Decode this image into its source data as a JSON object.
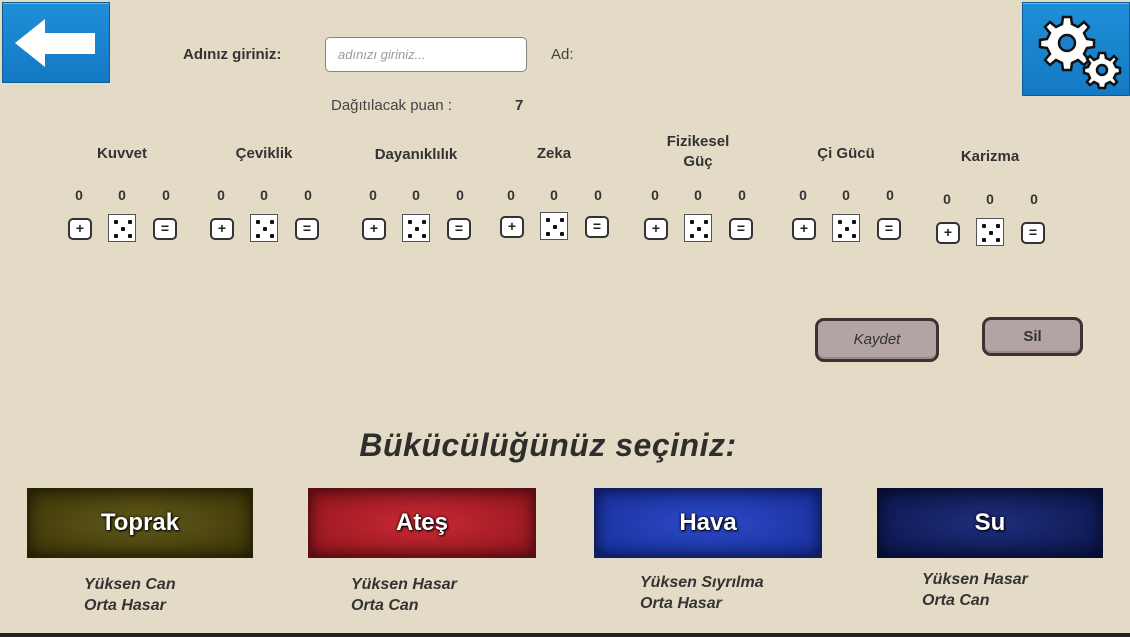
{
  "header": {
    "back_icon": "arrow-left-icon",
    "settings_icon": "gears-icon",
    "accent": "#1880cc"
  },
  "name": {
    "label": "Adınız giriniz:",
    "placeholder": "adınızı giriniz...",
    "value": "",
    "ad_label": "Ad:"
  },
  "points": {
    "label": "Dağıtılacak puan :",
    "value": "7"
  },
  "stats": [
    {
      "name": "Kuvvet",
      "values": [
        "0",
        "0",
        "0"
      ],
      "plus": "+",
      "minus": "=",
      "die_face": 5
    },
    {
      "name": "Çeviklik",
      "values": [
        "0",
        "0",
        "0"
      ],
      "plus": "+",
      "minus": "=",
      "die_face": 5
    },
    {
      "name": "Dayanıklılık",
      "values": [
        "0",
        "0",
        "0"
      ],
      "plus": "+",
      "minus": "=",
      "die_face": 5
    },
    {
      "name": "Zeka",
      "values": [
        "0",
        "0",
        "0"
      ],
      "plus": "+",
      "minus": "=",
      "die_face": 5
    },
    {
      "name": "Fizikesel\nGüç",
      "values": [
        "0",
        "0",
        "0"
      ],
      "plus": "+",
      "minus": "=",
      "die_face": 5
    },
    {
      "name": "Çi Gücü",
      "values": [
        "0",
        "0",
        "0"
      ],
      "plus": "+",
      "minus": "=",
      "die_face": 5
    },
    {
      "name": "Karizma",
      "values": [
        "0",
        "0",
        "0"
      ],
      "plus": "+",
      "minus": "=",
      "die_face": 5
    }
  ],
  "actions": {
    "save": "Kaydet",
    "delete": "Sil"
  },
  "bending": {
    "title": "Bükücülüğünüz seçiniz:",
    "elements": [
      {
        "label": "Toprak",
        "desc1": "Yüksen Can",
        "desc2": "Orta Hasar",
        "color": "#4d4510"
      },
      {
        "label": "Ateş",
        "desc1": "Yüksen Hasar",
        "desc2": "Orta Can",
        "color": "#b3202a"
      },
      {
        "label": "Hava",
        "desc1": "Yüksen Sıyrılma",
        "desc2": "Orta Hasar",
        "color": "#2239b4"
      },
      {
        "label": "Su",
        "desc1": "Yüksen Hasar",
        "desc2": "Orta Can",
        "color": "#14205f"
      }
    ]
  }
}
